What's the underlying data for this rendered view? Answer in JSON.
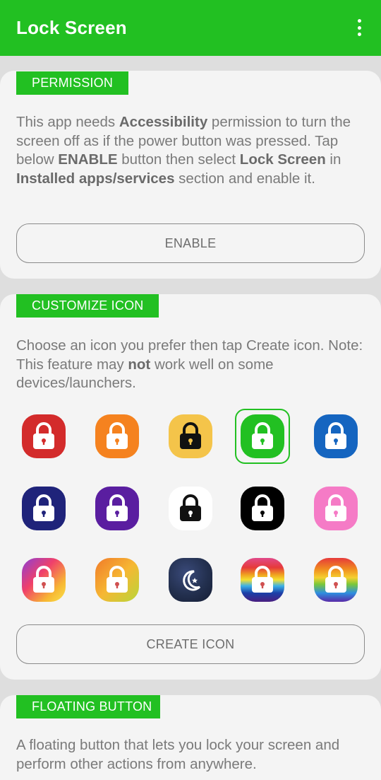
{
  "app": {
    "title": "Lock Screen",
    "menu_icon": "more-vert-icon"
  },
  "permission": {
    "tag": "PERMISSION",
    "desc": [
      {
        "t": "This app needs "
      },
      {
        "t": "Accessibility",
        "b": true
      },
      {
        "t": " permission to turn the screen off as if the power button was pressed. Tap below "
      },
      {
        "t": "ENABLE",
        "b": true
      },
      {
        "t": " button then select "
      },
      {
        "t": "Lock Screen",
        "b": true
      },
      {
        "t": " in "
      },
      {
        "t": "Installed apps/services",
        "b": true
      },
      {
        "t": " section and enable it."
      }
    ],
    "button": "ENABLE"
  },
  "customize": {
    "tag": "CUSTOMIZE ICON",
    "desc": [
      {
        "t": "Choose an icon you prefer then tap Create icon. Note: This feature may "
      },
      {
        "t": "not",
        "b": true
      },
      {
        "t": " work well on some devices/launchers."
      }
    ],
    "button": "CREATE ICON",
    "selected_icon": "green",
    "icons": [
      {
        "name": "red",
        "class": "c-red",
        "lock": "#ffffff",
        "glyph": "lock"
      },
      {
        "name": "orange",
        "class": "c-orange",
        "lock": "#ffffff",
        "glyph": "lock"
      },
      {
        "name": "yellow",
        "class": "c-yellow",
        "lock": "#111111",
        "glyph": "lock"
      },
      {
        "name": "green",
        "class": "c-green",
        "lock": "#ffffff",
        "glyph": "lock"
      },
      {
        "name": "blue",
        "class": "c-blue",
        "lock": "#ffffff",
        "glyph": "lock"
      },
      {
        "name": "navy",
        "class": "c-navy",
        "lock": "#ffffff",
        "glyph": "lock"
      },
      {
        "name": "purple",
        "class": "c-purple",
        "lock": "#ffffff",
        "glyph": "lock"
      },
      {
        "name": "white",
        "class": "c-white",
        "lock": "#111111",
        "glyph": "lock"
      },
      {
        "name": "black",
        "class": "c-black",
        "lock": "#ffffff",
        "glyph": "lock"
      },
      {
        "name": "pink",
        "class": "c-pink",
        "lock": "#ffffff",
        "glyph": "lock"
      },
      {
        "name": "sunset-gradient",
        "class": "c-sunset",
        "lock": "#ffffff",
        "glyph": "lock"
      },
      {
        "name": "warm-gradient",
        "class": "c-warm",
        "lock": "#ffffff",
        "glyph": "lock"
      },
      {
        "name": "night-moon",
        "class": "c-night",
        "lock": "#ffffff",
        "glyph": "moon"
      },
      {
        "name": "rainbow-stripes",
        "class": "c-rainbow1",
        "lock": "#ffffff",
        "glyph": "lock"
      },
      {
        "name": "rainbow-gradient",
        "class": "c-rainbow2",
        "lock": "#ffffff",
        "glyph": "lock"
      }
    ]
  },
  "floating": {
    "tag": "FLOATING BUTTON",
    "desc": [
      {
        "t": "A floating button that lets you lock your screen and perform other actions from anywhere."
      }
    ]
  },
  "colors": {
    "accent": "#22c022",
    "card": "#f4f4f4",
    "background": "#dedede"
  }
}
